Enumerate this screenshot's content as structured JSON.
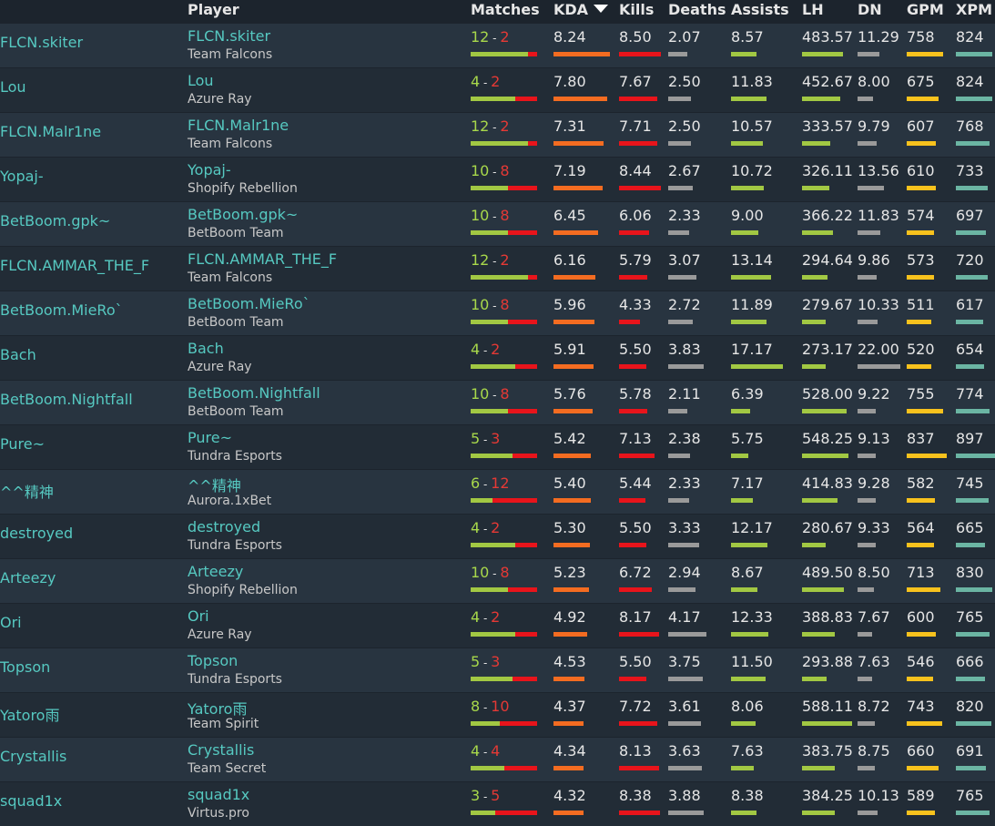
{
  "headers": {
    "player": "Player",
    "matches": "Matches",
    "kda": "KDA",
    "kills": "Kills",
    "deaths": "Deaths",
    "assists": "Assists",
    "lh": "LH",
    "dn": "DN",
    "gpm": "GPM",
    "xpm": "XPM"
  },
  "sort_icon": "caret-down-icon",
  "colors": {
    "link": "#56c9c1",
    "win": "#a8d84b",
    "loss": "#e53935",
    "kda_bar": "#f46c21",
    "kills_bar": "#e8141b",
    "neutral_bar": "#9a9a9a",
    "assists_bar": "#a2c843",
    "gpm_bar": "#f8c21d",
    "xpm_bar": "#6bb5a3"
  },
  "rows": [
    {
      "name": "FLCN.skiter",
      "team": "Team Falcons",
      "w": "12",
      "l": "2",
      "kda": "8.24",
      "kills": "8.50",
      "deaths": "2.07",
      "assists": "8.57",
      "lh": "483.57",
      "dn": "11.29",
      "gpm": "758",
      "xpm": "824"
    },
    {
      "name": "Lou",
      "team": "Azure Ray",
      "w": "4",
      "l": "2",
      "kda": "7.80",
      "kills": "7.67",
      "deaths": "2.50",
      "assists": "11.83",
      "lh": "452.67",
      "dn": "8.00",
      "gpm": "675",
      "xpm": "824"
    },
    {
      "name": "FLCN.Malr1ne",
      "team": "Team Falcons",
      "w": "12",
      "l": "2",
      "kda": "7.31",
      "kills": "7.71",
      "deaths": "2.50",
      "assists": "10.57",
      "lh": "333.57",
      "dn": "9.79",
      "gpm": "607",
      "xpm": "768"
    },
    {
      "name": "Yopaj-",
      "team": "Shopify Rebellion",
      "w": "10",
      "l": "8",
      "kda": "7.19",
      "kills": "8.44",
      "deaths": "2.67",
      "assists": "10.72",
      "lh": "326.11",
      "dn": "13.56",
      "gpm": "610",
      "xpm": "733"
    },
    {
      "name": "BetBoom.gpk~",
      "team": "BetBoom Team",
      "w": "10",
      "l": "8",
      "kda": "6.45",
      "kills": "6.06",
      "deaths": "2.33",
      "assists": "9.00",
      "lh": "366.22",
      "dn": "11.83",
      "gpm": "574",
      "xpm": "697"
    },
    {
      "name": "FLCN.AMMAR_THE_F",
      "team": "Team Falcons",
      "w": "12",
      "l": "2",
      "kda": "6.16",
      "kills": "5.79",
      "deaths": "3.07",
      "assists": "13.14",
      "lh": "294.64",
      "dn": "9.86",
      "gpm": "573",
      "xpm": "720"
    },
    {
      "name": "BetBoom.MieRo`",
      "team": "BetBoom Team",
      "w": "10",
      "l": "8",
      "kda": "5.96",
      "kills": "4.33",
      "deaths": "2.72",
      "assists": "11.89",
      "lh": "279.67",
      "dn": "10.33",
      "gpm": "511",
      "xpm": "617"
    },
    {
      "name": "Bach",
      "team": "Azure Ray",
      "w": "4",
      "l": "2",
      "kda": "5.91",
      "kills": "5.50",
      "deaths": "3.83",
      "assists": "17.17",
      "lh": "273.17",
      "dn": "22.00",
      "gpm": "520",
      "xpm": "654"
    },
    {
      "name": "BetBoom.Nightfall",
      "team": "BetBoom Team",
      "w": "10",
      "l": "8",
      "kda": "5.76",
      "kills": "5.78",
      "deaths": "2.11",
      "assists": "6.39",
      "lh": "528.00",
      "dn": "9.22",
      "gpm": "755",
      "xpm": "774"
    },
    {
      "name": "Pure~",
      "team": "Tundra Esports",
      "w": "5",
      "l": "3",
      "kda": "5.42",
      "kills": "7.13",
      "deaths": "2.38",
      "assists": "5.75",
      "lh": "548.25",
      "dn": "9.13",
      "gpm": "837",
      "xpm": "897"
    },
    {
      "name": "^^精神",
      "team": "Aurora.1xBet",
      "w": "6",
      "l": "12",
      "kda": "5.40",
      "kills": "5.44",
      "deaths": "2.33",
      "assists": "7.17",
      "lh": "414.83",
      "dn": "9.28",
      "gpm": "582",
      "xpm": "745"
    },
    {
      "name": "destroyed",
      "team": "Tundra Esports",
      "w": "4",
      "l": "2",
      "kda": "5.30",
      "kills": "5.50",
      "deaths": "3.33",
      "assists": "12.17",
      "lh": "280.67",
      "dn": "9.33",
      "gpm": "564",
      "xpm": "665"
    },
    {
      "name": "Arteezy",
      "team": "Shopify Rebellion",
      "w": "10",
      "l": "8",
      "kda": "5.23",
      "kills": "6.72",
      "deaths": "2.94",
      "assists": "8.67",
      "lh": "489.50",
      "dn": "8.50",
      "gpm": "713",
      "xpm": "830"
    },
    {
      "name": "Ori",
      "team": "Azure Ray",
      "w": "4",
      "l": "2",
      "kda": "4.92",
      "kills": "8.17",
      "deaths": "4.17",
      "assists": "12.33",
      "lh": "388.83",
      "dn": "7.67",
      "gpm": "600",
      "xpm": "765"
    },
    {
      "name": "Topson",
      "team": "Tundra Esports",
      "w": "5",
      "l": "3",
      "kda": "4.53",
      "kills": "5.50",
      "deaths": "3.75",
      "assists": "11.50",
      "lh": "293.88",
      "dn": "7.63",
      "gpm": "546",
      "xpm": "666"
    },
    {
      "name": "Yatoro雨",
      "team": "Team Spirit",
      "w": "8",
      "l": "10",
      "kda": "4.37",
      "kills": "7.72",
      "deaths": "3.61",
      "assists": "8.06",
      "lh": "588.11",
      "dn": "8.72",
      "gpm": "743",
      "xpm": "820"
    },
    {
      "name": "Crystallis",
      "team": "Team Secret",
      "w": "4",
      "l": "4",
      "kda": "4.34",
      "kills": "8.13",
      "deaths": "3.63",
      "assists": "7.63",
      "lh": "383.75",
      "dn": "8.75",
      "gpm": "660",
      "xpm": "691"
    },
    {
      "name": "squad1x",
      "team": "Virtus.pro",
      "w": "3",
      "l": "5",
      "kda": "4.32",
      "kills": "8.38",
      "deaths": "3.88",
      "assists": "8.38",
      "lh": "384.25",
      "dn": "10.13",
      "gpm": "589",
      "xpm": "765"
    }
  ]
}
